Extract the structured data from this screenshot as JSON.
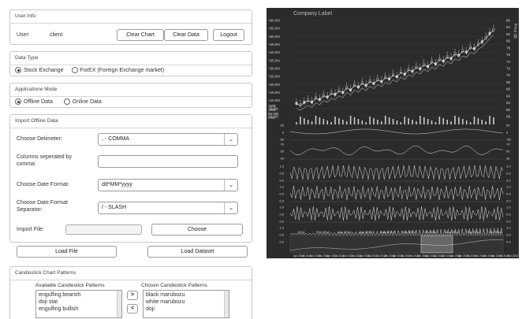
{
  "user_info": {
    "title": "User Info",
    "user_label": "User:",
    "user_value": "client",
    "clear_chart": "Clear Chart",
    "clear_data": "Clear Data",
    "logout": "Logout"
  },
  "data_type": {
    "title": "Data Type",
    "options": [
      "Stock Exchange",
      "ForEX (Foreign Exchange market)"
    ],
    "selected": "Stock Exchange"
  },
  "app_mode": {
    "title": "Applicatione Mode",
    "options": [
      "Offline Data",
      "Online Data"
    ],
    "selected": "Offline Data"
  },
  "import": {
    "title": "Import Offline Data",
    "delimiter_label": "Choose Delimeter:",
    "delimiter_value": ", - COMMA",
    "columns_label": "Columns seperated by comma:",
    "columns_value": "",
    "date_format_label": "Choose Date Format:",
    "date_format_value": "dd*MM*yyyy",
    "date_sep_label": "Choose Date Format Separator:",
    "date_sep_value": "/ - SLASH",
    "file_label": "Import File:",
    "choose_button": "Choose",
    "load_file_button": "Load File",
    "load_dataset_button": "Load Dataset"
  },
  "patterns": {
    "title": "Candlestick Chart Patterns",
    "available_label": "Available Candlestick Patterns",
    "chosen_label": "Chosen Candlestick Patterns",
    "available": [
      "engulfing bearish",
      "doji star",
      "engulfing bullish"
    ],
    "chosen": [
      "black marubozu",
      "white marubozu",
      "doji"
    ],
    "add_icon": ">",
    "remove_icon": "<"
  },
  "chart_data": {
    "type": "line",
    "title": "Company Label",
    "ylabel_right": "Price ($)",
    "left_pct_ticks": [
      "+60.0%",
      "+55.0%",
      "+50.0%",
      "+45.0%",
      "+40.0%",
      "+35.0%",
      "+30.0%",
      "+25.0%",
      "+20.0%",
      "+15.0%",
      "+10.0%",
      "+5.0%",
      "+0.0%"
    ],
    "right_price_ticks": [
      "86",
      "84",
      "82",
      "80",
      "78",
      "76",
      "74",
      "72",
      "70",
      "68",
      "66",
      "64",
      "62",
      "60",
      "58"
    ],
    "volume_labels": [
      "150k",
      "100k",
      "50.00k",
      "0.00"
    ],
    "x_ticks": [
      "2014",
      "Feb 2014",
      "Mar 2014",
      "Apr 2014",
      "May 2014",
      "Jun 2014",
      "Jul 2014",
      "Aug 2014",
      "Sep 2014",
      "Oct 2014"
    ],
    "nav_ticks": [
      "Apr 2010",
      "Jul 2010",
      "Oct 2010",
      "Jan 2011",
      "Apr 2011",
      "Jul 2011",
      "Oct 2011",
      "Jan 2012",
      "Apr 2012",
      "Jul 2012",
      "Oct 2012",
      "Jan 2013",
      "Apr 2013",
      "Jul 2013",
      "Oct 2013",
      "Jan 2014",
      "Apr 2014",
      "Jul 2014",
      "Oct 2014",
      "Jan 2015",
      "Apr 2015",
      "Jul 2015",
      "Oct 2015",
      "Jan 2016",
      "Apr 2016",
      "Jul 2016",
      "Oct 2016"
    ],
    "indicator_ticks": {
      "macd": [
        "50",
        "0",
        "-50"
      ],
      "rsi": [
        "70",
        "50",
        "30"
      ],
      "osc": [
        "1.0",
        "0.5",
        "0.0"
      ]
    },
    "series": [
      {
        "values": [
          62,
          61.5,
          62.3,
          63,
          62.4,
          63.8,
          63.2,
          64.5,
          64,
          65.2,
          64.8,
          66,
          65.4,
          67,
          66.2,
          67.8,
          67.1,
          68.4,
          67.6,
          69,
          68.2,
          69.5,
          68.8,
          70.2,
          69.6,
          71,
          70.3,
          71.8,
          71.1,
          72.6,
          72,
          73.4,
          72.8,
          74.2,
          73.5,
          75,
          74.3,
          75.8,
          75.2,
          76.6,
          76,
          77.5,
          77,
          78.4,
          78,
          79.5,
          79.1,
          80.5,
          81.2,
          82.5,
          83.8,
          85
        ]
      }
    ]
  }
}
